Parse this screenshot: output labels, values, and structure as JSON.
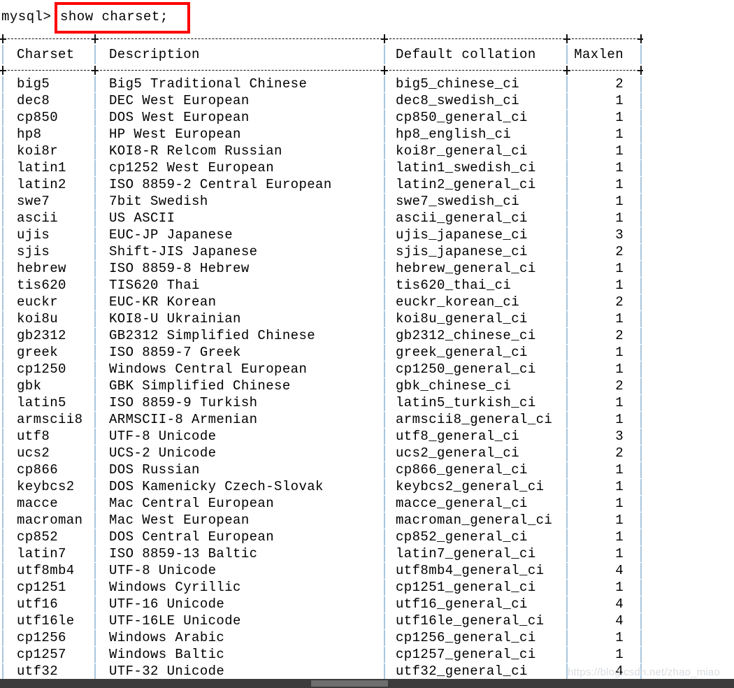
{
  "terminal": {
    "prompt": "mysql>",
    "command": "show charset;",
    "highlight_color": "#ff0000"
  },
  "table": {
    "headers": {
      "charset": "Charset",
      "description": "Description",
      "collation": "Default collation",
      "maxlen": "Maxlen"
    },
    "rows": [
      {
        "charset": "big5",
        "description": "Big5 Traditional Chinese",
        "collation": "big5_chinese_ci",
        "maxlen": "2"
      },
      {
        "charset": "dec8",
        "description": "DEC West European",
        "collation": "dec8_swedish_ci",
        "maxlen": "1"
      },
      {
        "charset": "cp850",
        "description": "DOS West European",
        "collation": "cp850_general_ci",
        "maxlen": "1"
      },
      {
        "charset": "hp8",
        "description": "HP West European",
        "collation": "hp8_english_ci",
        "maxlen": "1"
      },
      {
        "charset": "koi8r",
        "description": "KOI8-R Relcom Russian",
        "collation": "koi8r_general_ci",
        "maxlen": "1"
      },
      {
        "charset": "latin1",
        "description": "cp1252 West European",
        "collation": "latin1_swedish_ci",
        "maxlen": "1"
      },
      {
        "charset": "latin2",
        "description": "ISO 8859-2 Central European",
        "collation": "latin2_general_ci",
        "maxlen": "1"
      },
      {
        "charset": "swe7",
        "description": "7bit Swedish",
        "collation": "swe7_swedish_ci",
        "maxlen": "1"
      },
      {
        "charset": "ascii",
        "description": "US ASCII",
        "collation": "ascii_general_ci",
        "maxlen": "1"
      },
      {
        "charset": "ujis",
        "description": "EUC-JP Japanese",
        "collation": "ujis_japanese_ci",
        "maxlen": "3"
      },
      {
        "charset": "sjis",
        "description": "Shift-JIS Japanese",
        "collation": "sjis_japanese_ci",
        "maxlen": "2"
      },
      {
        "charset": "hebrew",
        "description": "ISO 8859-8 Hebrew",
        "collation": "hebrew_general_ci",
        "maxlen": "1"
      },
      {
        "charset": "tis620",
        "description": "TIS620 Thai",
        "collation": "tis620_thai_ci",
        "maxlen": "1"
      },
      {
        "charset": "euckr",
        "description": "EUC-KR Korean",
        "collation": "euckr_korean_ci",
        "maxlen": "2"
      },
      {
        "charset": "koi8u",
        "description": "KOI8-U Ukrainian",
        "collation": "koi8u_general_ci",
        "maxlen": "1"
      },
      {
        "charset": "gb2312",
        "description": "GB2312 Simplified Chinese",
        "collation": "gb2312_chinese_ci",
        "maxlen": "2"
      },
      {
        "charset": "greek",
        "description": "ISO 8859-7 Greek",
        "collation": "greek_general_ci",
        "maxlen": "1"
      },
      {
        "charset": "cp1250",
        "description": "Windows Central European",
        "collation": "cp1250_general_ci",
        "maxlen": "1"
      },
      {
        "charset": "gbk",
        "description": "GBK Simplified Chinese",
        "collation": "gbk_chinese_ci",
        "maxlen": "2"
      },
      {
        "charset": "latin5",
        "description": "ISO 8859-9 Turkish",
        "collation": "latin5_turkish_ci",
        "maxlen": "1"
      },
      {
        "charset": "armscii8",
        "description": "ARMSCII-8 Armenian",
        "collation": "armscii8_general_ci",
        "maxlen": "1"
      },
      {
        "charset": "utf8",
        "description": "UTF-8 Unicode",
        "collation": "utf8_general_ci",
        "maxlen": "3"
      },
      {
        "charset": "ucs2",
        "description": "UCS-2 Unicode",
        "collation": "ucs2_general_ci",
        "maxlen": "2"
      },
      {
        "charset": "cp866",
        "description": "DOS Russian",
        "collation": "cp866_general_ci",
        "maxlen": "1"
      },
      {
        "charset": "keybcs2",
        "description": "DOS Kamenicky Czech-Slovak",
        "collation": "keybcs2_general_ci",
        "maxlen": "1"
      },
      {
        "charset": "macce",
        "description": "Mac Central European",
        "collation": "macce_general_ci",
        "maxlen": "1"
      },
      {
        "charset": "macroman",
        "description": "Mac West European",
        "collation": "macroman_general_ci",
        "maxlen": "1"
      },
      {
        "charset": "cp852",
        "description": "DOS Central European",
        "collation": "cp852_general_ci",
        "maxlen": "1"
      },
      {
        "charset": "latin7",
        "description": "ISO 8859-13 Baltic",
        "collation": "latin7_general_ci",
        "maxlen": "1"
      },
      {
        "charset": "utf8mb4",
        "description": "UTF-8 Unicode",
        "collation": "utf8mb4_general_ci",
        "maxlen": "4"
      },
      {
        "charset": "cp1251",
        "description": "Windows Cyrillic",
        "collation": "cp1251_general_ci",
        "maxlen": "1"
      },
      {
        "charset": "utf16",
        "description": "UTF-16 Unicode",
        "collation": "utf16_general_ci",
        "maxlen": "4"
      },
      {
        "charset": "utf16le",
        "description": "UTF-16LE Unicode",
        "collation": "utf16le_general_ci",
        "maxlen": "4"
      },
      {
        "charset": "cp1256",
        "description": "Windows Arabic",
        "collation": "cp1256_general_ci",
        "maxlen": "1"
      },
      {
        "charset": "cp1257",
        "description": "Windows Baltic",
        "collation": "cp1257_general_ci",
        "maxlen": "1"
      },
      {
        "charset": "utf32",
        "description": "UTF-32 Unicode",
        "collation": "utf32_general_ci",
        "maxlen": "4"
      }
    ]
  },
  "watermark": {
    "text": "https://blog.csdn.net/zhao_miao"
  }
}
